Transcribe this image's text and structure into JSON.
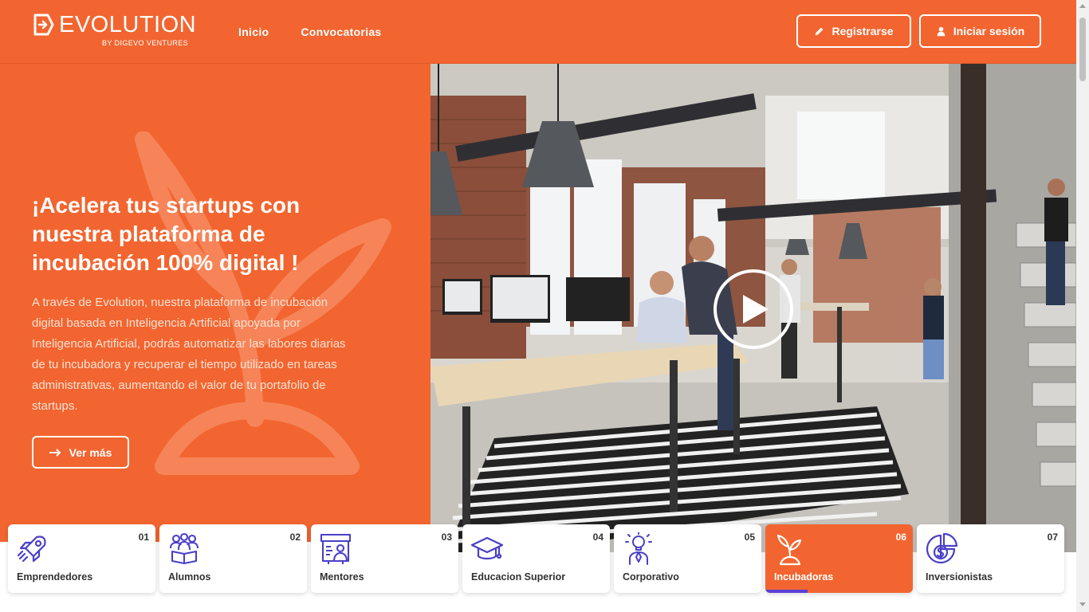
{
  "header": {
    "logo_text": "EVOLUTION",
    "logo_sub": "BY DIGEVO VENTURES",
    "nav": [
      {
        "label": "Inicio"
      },
      {
        "label": "Convocatorias"
      }
    ],
    "register_label": "Registrarse",
    "register_icon": "pencil-icon",
    "login_label": "Iniciar sesión",
    "login_icon": "user-icon"
  },
  "hero": {
    "title": "¡Acelera tus startups con nuestra plataforma de incubación 100% digital !",
    "text": "A través de Evolution, nuestra plataforma de incubación digital basada en Inteligencia Artificial apoyada por Inteligencia Artificial, podrás automatizar las labores diarias de tu incubadora y recuperar el tiempo utilizado en tareas administrativas, aumentando el valor de tu portafolio de startups.",
    "cta_label": "Ver más",
    "cta_icon": "arrow-right-icon",
    "media_icon": "play-icon"
  },
  "categories": [
    {
      "num": "01",
      "label": "Emprendedores",
      "icon": "rocket-icon"
    },
    {
      "num": "02",
      "label": "Alumnos",
      "icon": "students-icon"
    },
    {
      "num": "03",
      "label": "Mentores",
      "icon": "mentor-board-icon"
    },
    {
      "num": "04",
      "label": "Educacion Superior",
      "icon": "graduation-cap-icon"
    },
    {
      "num": "05",
      "label": "Corporativo",
      "icon": "lightbulb-person-icon"
    },
    {
      "num": "06",
      "label": "Incubadoras",
      "icon": "sprout-icon",
      "active": true
    },
    {
      "num": "07",
      "label": "Inversionistas",
      "icon": "coin-chart-icon"
    }
  ],
  "colors": {
    "brand_orange": "#f26530",
    "icon_blue": "#4a3fc7",
    "active_underline": "#5b3fd6"
  }
}
